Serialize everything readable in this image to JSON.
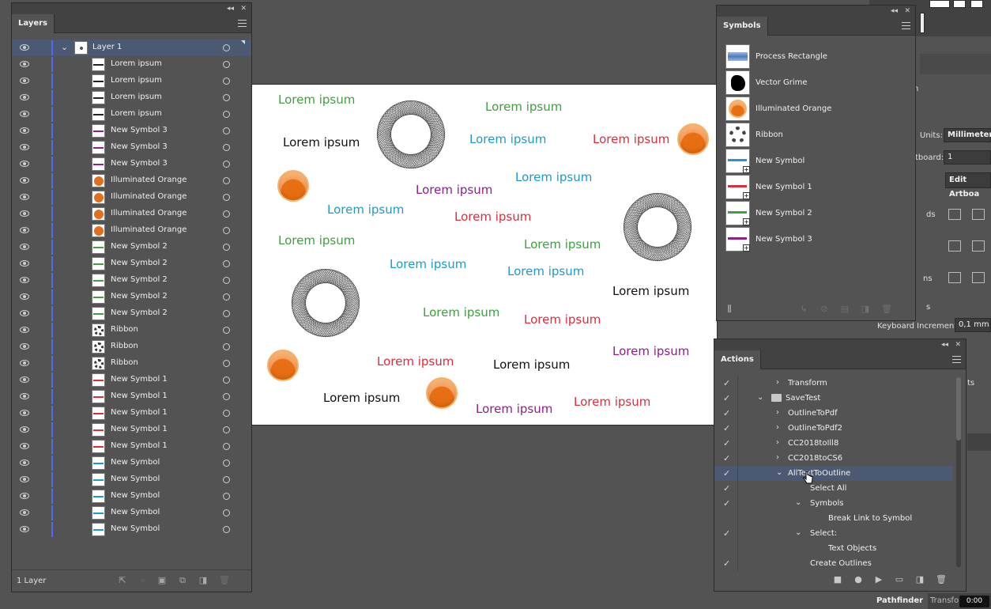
{
  "layers_panel": {
    "tab": "Layers",
    "layer_count": "1 Layer",
    "rows": [
      {
        "name": "Layer 1",
        "thumb": "layer1",
        "top": true
      },
      {
        "name": "Lorem ipsum",
        "thumb": "text-black"
      },
      {
        "name": "Lorem ipsum",
        "thumb": "text-black"
      },
      {
        "name": "Lorem ipsum",
        "thumb": "text-black"
      },
      {
        "name": "Lorem ipsum",
        "thumb": "text-black"
      },
      {
        "name": "New Symbol 3",
        "thumb": "text-purple"
      },
      {
        "name": "New Symbol 3",
        "thumb": "text-purple"
      },
      {
        "name": "New Symbol 3",
        "thumb": "text-purple"
      },
      {
        "name": "Illuminated Orange",
        "thumb": "orange"
      },
      {
        "name": "Illuminated Orange",
        "thumb": "orange"
      },
      {
        "name": "Illuminated Orange",
        "thumb": "orange"
      },
      {
        "name": "Illuminated Orange",
        "thumb": "orange"
      },
      {
        "name": "New Symbol 2",
        "thumb": "text-green"
      },
      {
        "name": "New Symbol 2",
        "thumb": "text-green"
      },
      {
        "name": "New Symbol 2",
        "thumb": "text-green"
      },
      {
        "name": "New Symbol 2",
        "thumb": "text-green"
      },
      {
        "name": "New Symbol 2",
        "thumb": "text-green"
      },
      {
        "name": "Ribbon",
        "thumb": "ribbon"
      },
      {
        "name": "Ribbon",
        "thumb": "ribbon"
      },
      {
        "name": "Ribbon",
        "thumb": "ribbon"
      },
      {
        "name": "New Symbol 1",
        "thumb": "text-red"
      },
      {
        "name": "New Symbol 1",
        "thumb": "text-red"
      },
      {
        "name": "New Symbol 1",
        "thumb": "text-red"
      },
      {
        "name": "New Symbol 1",
        "thumb": "text-red"
      },
      {
        "name": "New Symbol 1",
        "thumb": "text-red"
      },
      {
        "name": "New Symbol",
        "thumb": "text-blue"
      },
      {
        "name": "New Symbol",
        "thumb": "text-blue"
      },
      {
        "name": "New Symbol",
        "thumb": "text-blue"
      },
      {
        "name": "New Symbol",
        "thumb": "text-blue"
      },
      {
        "name": "New Symbol",
        "thumb": "text-blue"
      }
    ]
  },
  "canvas": {
    "text": "Lorem ipsum",
    "colors": {
      "green": "#3ea03e",
      "black": "#111111",
      "blue": "#1b9ad0",
      "red": "#dc2e3a",
      "purple": "#8e1e8e",
      "orange": "#e56e10"
    }
  },
  "symbols_panel": {
    "tab": "Symbols",
    "items": [
      {
        "name": "Process Rectangle",
        "thumb": "process-rectangle"
      },
      {
        "name": "Vector Grime",
        "thumb": "vector-grime"
      },
      {
        "name": "Illuminated Orange",
        "thumb": "orange"
      },
      {
        "name": "Ribbon",
        "thumb": "ribbon"
      },
      {
        "name": "New Symbol",
        "thumb": "text-blue",
        "plus": true
      },
      {
        "name": "New Symbol 1",
        "thumb": "text-red",
        "plus": true
      },
      {
        "name": "New Symbol 2",
        "thumb": "text-green",
        "plus": true
      },
      {
        "name": "New Symbol 3",
        "thumb": "text-purple",
        "plus": true
      }
    ]
  },
  "actions_panel": {
    "tab": "Actions",
    "rows": [
      {
        "name": "Transform",
        "check": true,
        "arrow": "›",
        "indent": 1
      },
      {
        "name": "SaveTest",
        "check": true,
        "arrow": "⌄",
        "indent": 0,
        "folder": true
      },
      {
        "name": "OutlineToPdf",
        "check": true,
        "arrow": "›",
        "indent": 1
      },
      {
        "name": "OutlineToPdf2",
        "check": true,
        "arrow": "›",
        "indent": 1
      },
      {
        "name": "CC2018toIll8",
        "check": true,
        "arrow": "›",
        "indent": 1
      },
      {
        "name": "CC2018toCS6",
        "check": true,
        "arrow": "›",
        "indent": 1
      },
      {
        "name": "AllTextToOutline",
        "check": true,
        "arrow": "⌄",
        "indent": 1,
        "selected": true
      },
      {
        "name": "Select All",
        "check": true,
        "arrow": "",
        "indent": 2
      },
      {
        "name": "Symbols",
        "check": true,
        "arrow": "⌄",
        "indent": 2
      },
      {
        "name": "Break Link to Symbol",
        "check": false,
        "arrow": "",
        "indent": 3
      },
      {
        "name": "Select:",
        "check": true,
        "arrow": "⌄",
        "indent": 2
      },
      {
        "name": "Text Objects",
        "check": false,
        "arrow": "",
        "indent": 3
      },
      {
        "name": "Create Outlines",
        "check": true,
        "arrow": "",
        "indent": 2
      }
    ]
  },
  "properties_partial": {
    "partial_n": "n",
    "units_label": "Units:",
    "units_value": "Millimeters",
    "artboard_label": "tboard:",
    "artboard_value": "1",
    "edit_artboards": "Edit Artboa",
    "ds": "ds",
    "ns": "ns",
    "s": "s",
    "keyboard_increment_label": "Keyboard Increment:",
    "keyboard_increment_value": "0,1 mm",
    "ts": "ts"
  },
  "bottom_tabs": {
    "pathfinder": "Pathfinder",
    "transform": "Transfo"
  },
  "badge": "0:00"
}
